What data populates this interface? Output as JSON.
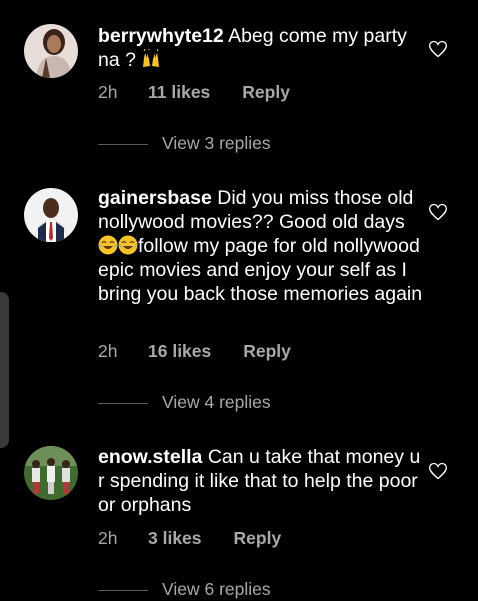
{
  "comments": [
    {
      "username": "berrywhyte12",
      "text_parts": [
        "Abeg come my party na ? "
      ],
      "emoji": [
        "raising-hands"
      ],
      "time": "2h",
      "likes": "11 likes",
      "reply": "Reply",
      "view_replies": "View 3 replies"
    },
    {
      "username": "gainersbase",
      "text_before": "Did you miss those old nollywood movies?? Good old days ",
      "emoji": [
        "face-with-tears-of-joy",
        "face-with-tears-of-joy"
      ],
      "text_after": "follow my page for old nollywood epic movies and enjoy your self as I bring you back those memories again",
      "time": "2h",
      "likes": "16 likes",
      "reply": "Reply",
      "view_replies": "View 4 replies"
    },
    {
      "username": "enow.stella",
      "text": "Can u take that money u r spending it like that to help the poor or orphans",
      "time": "2h",
      "likes": "3 likes",
      "reply": "Reply",
      "view_replies": "View 6 replies"
    }
  ],
  "colors": {
    "background": "#000000",
    "text": "#ffffff",
    "secondary": "#a8a8a8",
    "divider": "#5a5a5a",
    "emoji_yellow": "#f7c325"
  },
  "icons": {
    "like": "heart-outline-icon",
    "avatar": "profile-avatar"
  }
}
